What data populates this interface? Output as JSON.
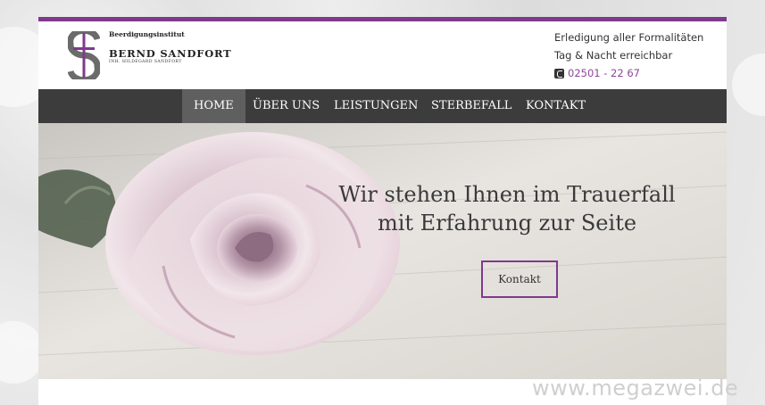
{
  "header": {
    "brand_small": "Beerdigungsinstitut",
    "brand_name": "BERND SANDFORT",
    "brand_owner": "INH. HILDEGARD SANDFORT",
    "info_line1": "Erledigung aller Formalitäten",
    "info_line2": "Tag & Nacht erreichbar",
    "phone": "02501 - 22 67"
  },
  "nav": {
    "items": [
      {
        "label": "HOME"
      },
      {
        "label": "ÜBER UNS"
      },
      {
        "label": "LEISTUNGEN"
      },
      {
        "label": "STERBEFALL"
      },
      {
        "label": "KONTAKT"
      }
    ]
  },
  "hero": {
    "line1": "Wir stehen Ihnen im Trauerfall",
    "line2": "mit Erfahrung zur Seite",
    "button": "Kontakt"
  },
  "watermark": "www.megazwei.de",
  "colors": {
    "accent": "#7e3a8c",
    "nav_bg": "#3c3c3c",
    "nav_active": "#5f5f5f",
    "phone": "#8d4697"
  }
}
